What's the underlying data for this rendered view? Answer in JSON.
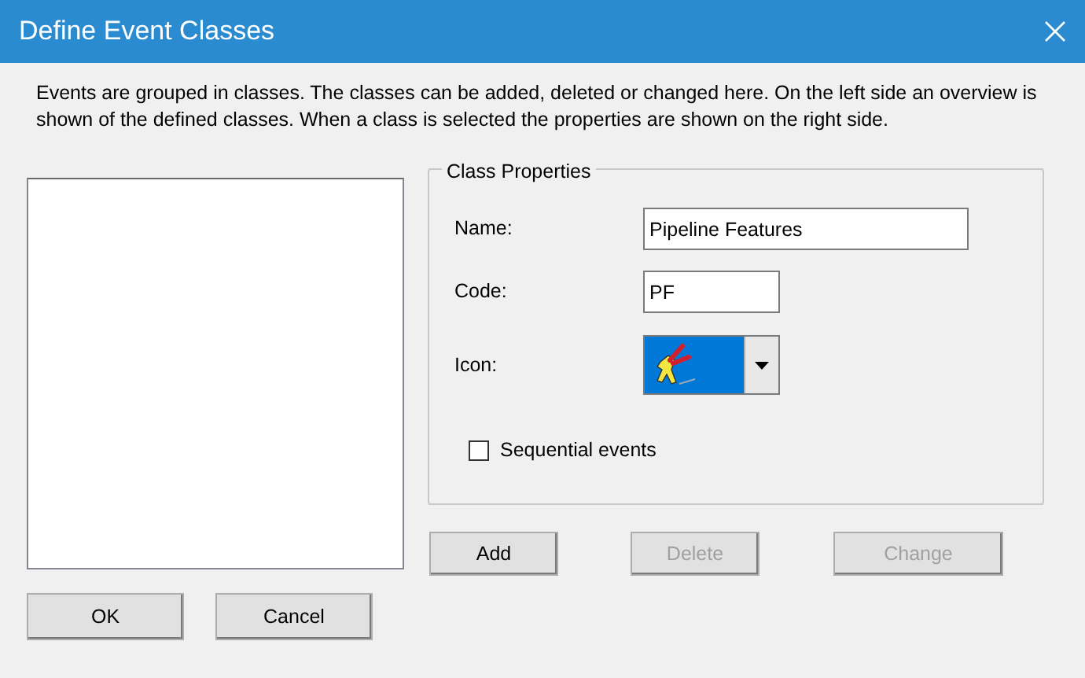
{
  "window": {
    "title": "Define Event Classes"
  },
  "description": "Events are grouped in classes. The classes can be added, deleted or changed here. On the left side an overview is shown of the defined classes. When a class is selected the properties are shown on the right side.",
  "class_properties": {
    "title": "Class Properties",
    "fields": [
      {
        "kind": "text",
        "label": "Name:",
        "value": "Pipeline Features"
      },
      {
        "kind": "text",
        "label": "Code:",
        "value": "PF"
      },
      {
        "kind": "icon",
        "label": "Icon:"
      }
    ],
    "sequential_events": {
      "label": "Sequential events",
      "checked": false
    }
  },
  "action_buttons": [
    {
      "label": "Add",
      "disabled": false
    },
    {
      "label": "Delete",
      "disabled": true
    },
    {
      "label": "Change",
      "disabled": true
    }
  ],
  "dialog_buttons": [
    {
      "label": "OK"
    },
    {
      "label": "Cancel"
    }
  ]
}
